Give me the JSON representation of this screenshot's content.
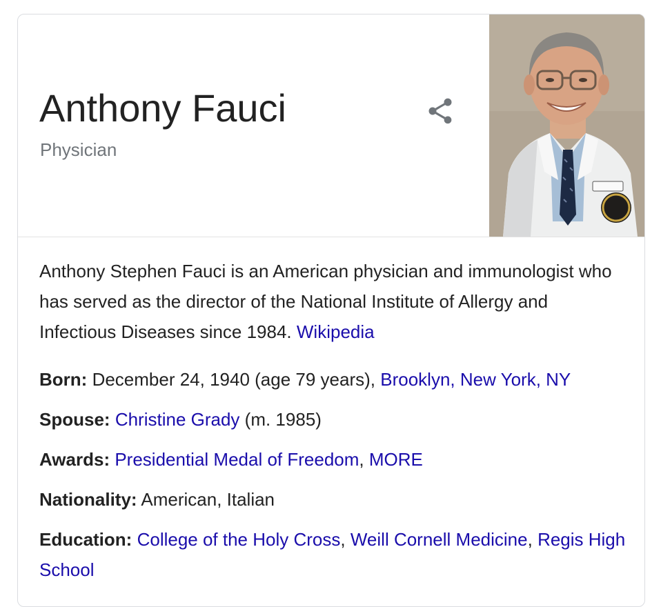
{
  "entity": {
    "name": "Anthony Fauci",
    "type": "Physician"
  },
  "description": {
    "text": "Anthony Stephen Fauci is an American physician and immunologist who has served as the director of the National Institute of Allergy and Infectious Diseases since 1984.",
    "source_link": "Wikipedia"
  },
  "facts": {
    "born": {
      "label": "Born:",
      "value": "December 24, 1940 (age 79 years),",
      "place_link": "Brooklyn, New York, NY"
    },
    "spouse": {
      "label": "Spouse:",
      "name_link": "Christine Grady",
      "suffix": "(m. 1985)"
    },
    "awards": {
      "label": "Awards:",
      "award_link": "Presidential Medal of Freedom",
      "separator": ",",
      "more_link": "MORE"
    },
    "nationality": {
      "label": "Nationality:",
      "value": "American, Italian"
    },
    "education": {
      "label": "Education:",
      "school1": "College of the Holy Cross",
      "sep1": ",",
      "school2": "Weill Cornell Medicine",
      "sep2": ",",
      "school3": "Regis High School"
    }
  },
  "icons": {
    "share": "share-icon"
  },
  "colors": {
    "link": "#1a0dab",
    "text": "#222222",
    "muted": "#70757a",
    "border": "#dadce0"
  }
}
